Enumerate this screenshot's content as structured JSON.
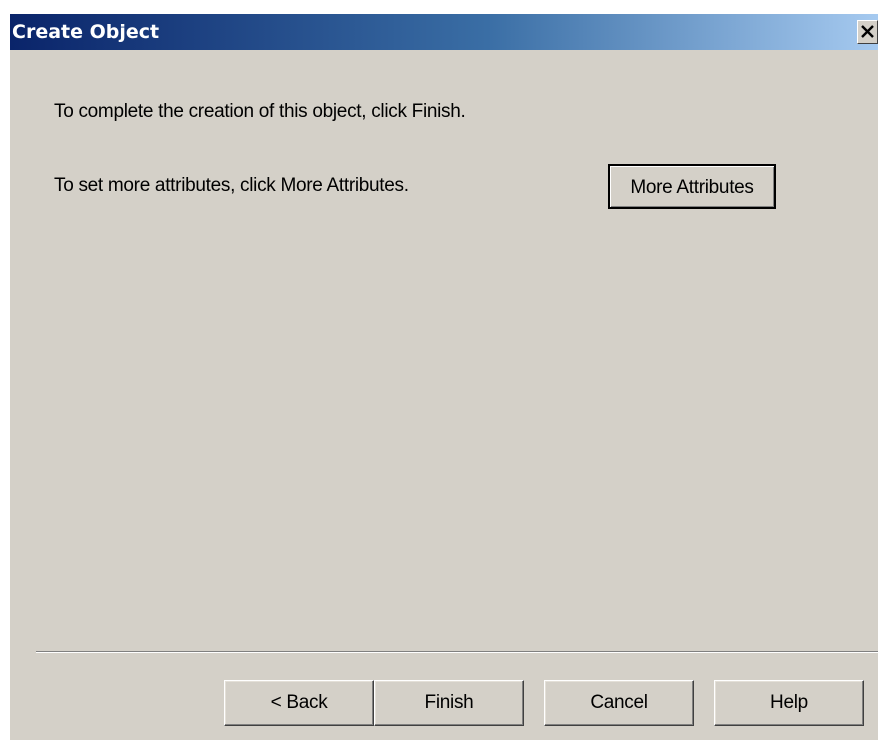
{
  "window": {
    "title": "Create Object"
  },
  "content": {
    "finish_message": "To complete the creation of this object, click Finish.",
    "attributes_message": "To set more attributes, click More Attributes.",
    "more_attributes_label": "More Attributes"
  },
  "footer": {
    "back_label": "< Back",
    "finish_label": "Finish",
    "cancel_label": "Cancel",
    "help_label": "Help"
  },
  "icons": {
    "close": "close-icon"
  },
  "colors": {
    "titlebar_start": "#0a246a",
    "titlebar_end": "#a6caf0",
    "dialog_background": "#d4d0c8"
  }
}
